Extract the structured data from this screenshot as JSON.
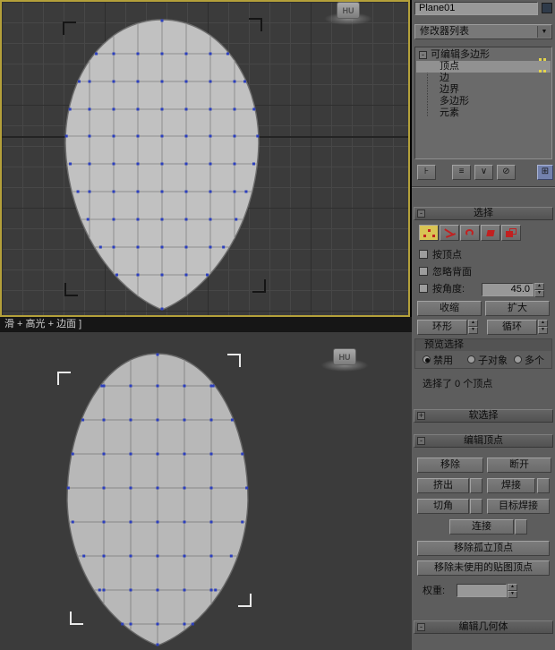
{
  "icons": {
    "dropdown_arrow": "▼",
    "spinner_up": "▲",
    "spinner_down": "▼",
    "minus": "-",
    "plus": "+",
    "pin": "⊦",
    "show_end": "≡",
    "make_unique": "∨",
    "remove_mod": "⊘",
    "configure": "⊞"
  },
  "viewport": {
    "shading_label": "滑 + 高光 + 边面 ]",
    "watermark": "HU"
  },
  "panel": {
    "object_name": "Plane01",
    "modifier_list": "修改器列表",
    "stack": {
      "root": "可编辑多边形",
      "items": [
        "顶点",
        "边",
        "边界",
        "多边形",
        "元素"
      ],
      "selected": "顶点"
    },
    "selection": {
      "title": "选择",
      "by_vertex": "按顶点",
      "ignore_backfacing": "忽略背面",
      "by_angle": "按角度:",
      "angle_value": "45.0",
      "shrink": "收缩",
      "grow": "扩大",
      "ring": "环形",
      "loop": "循环",
      "preview_title": "预览选择",
      "radio_disable": "禁用",
      "radio_subobj": "子对象",
      "radio_multi": "多个",
      "radio_selected": "禁用",
      "status": "选择了 0 个顶点"
    },
    "soft_selection": {
      "title": "软选择"
    },
    "edit_vertices": {
      "title": "编辑顶点",
      "remove": "移除",
      "break": "断开",
      "extrude": "挤出",
      "weld": "焊接",
      "chamfer": "切角",
      "target_weld": "目标焊接",
      "connect": "连接",
      "remove_isolated": "移除孤立顶点",
      "remove_unused_map": "移除未使用的贴图顶点",
      "weight": "权重:",
      "weight_value": ""
    },
    "edit_geometry": {
      "title": "编辑几何体"
    }
  }
}
